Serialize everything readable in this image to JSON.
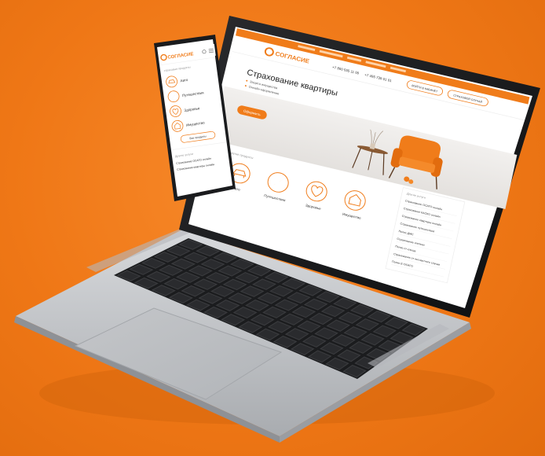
{
  "colors": {
    "background": "#f07c1a",
    "accent": "#f07c1a",
    "laptop_body": "#c9cbce",
    "keyboard": "#1b1c1e"
  },
  "laptop_site": {
    "logo_text": "СОГЛАСИЕ",
    "phone_1": "+7 800 555 11 00",
    "phone_2": "+7 495 739 01 01",
    "pill_button_1": "ВОЙТИ В КАБИНЕТ",
    "pill_button_2": "СТРАХОВОЙ СЛУЧАЙ",
    "hero_title": "Страхование квартиры",
    "hero_bullet_1": "Защита имущества",
    "hero_bullet_2": "Онлайн-оформление",
    "hero_button": "Оформить",
    "section_label": "другие продукты",
    "categories": [
      {
        "label": "Авто",
        "icon": "car-icon"
      },
      {
        "label": "Путешествия",
        "icon": "compass-icon"
      },
      {
        "label": "Здоровье",
        "icon": "heart-icon"
      },
      {
        "label": "Имущество",
        "icon": "house-icon"
      }
    ],
    "sidebar_title": "Другие услуги",
    "sidebar_items": [
      "Страхование ОСАГО онлайн",
      "Страхование КАСКО онлайн",
      "Страхование квартиры онлайн",
      "Страхование путешествий",
      "Полис ДМС",
      "Страхование ипотеки",
      "Полис от клеща",
      "Страхование от несчастного случая",
      "Полис Е-ОСАГО"
    ]
  },
  "phone_site": {
    "logo_text": "СОГЛАСИЕ",
    "section_label": "страховые продукты",
    "menu": [
      {
        "label": "Авто",
        "icon": "car-icon"
      },
      {
        "label": "Путешествия",
        "icon": "compass-icon"
      },
      {
        "label": "Здоровье",
        "icon": "heart-icon"
      },
      {
        "label": "Имущество",
        "icon": "house-icon"
      }
    ],
    "all_button": "Все продукты",
    "footer_label": "Другие услуги",
    "footer_line_1": "Страхование ОСАГО онлайн",
    "footer_line_2": "Страхование квартиры онлайн"
  }
}
